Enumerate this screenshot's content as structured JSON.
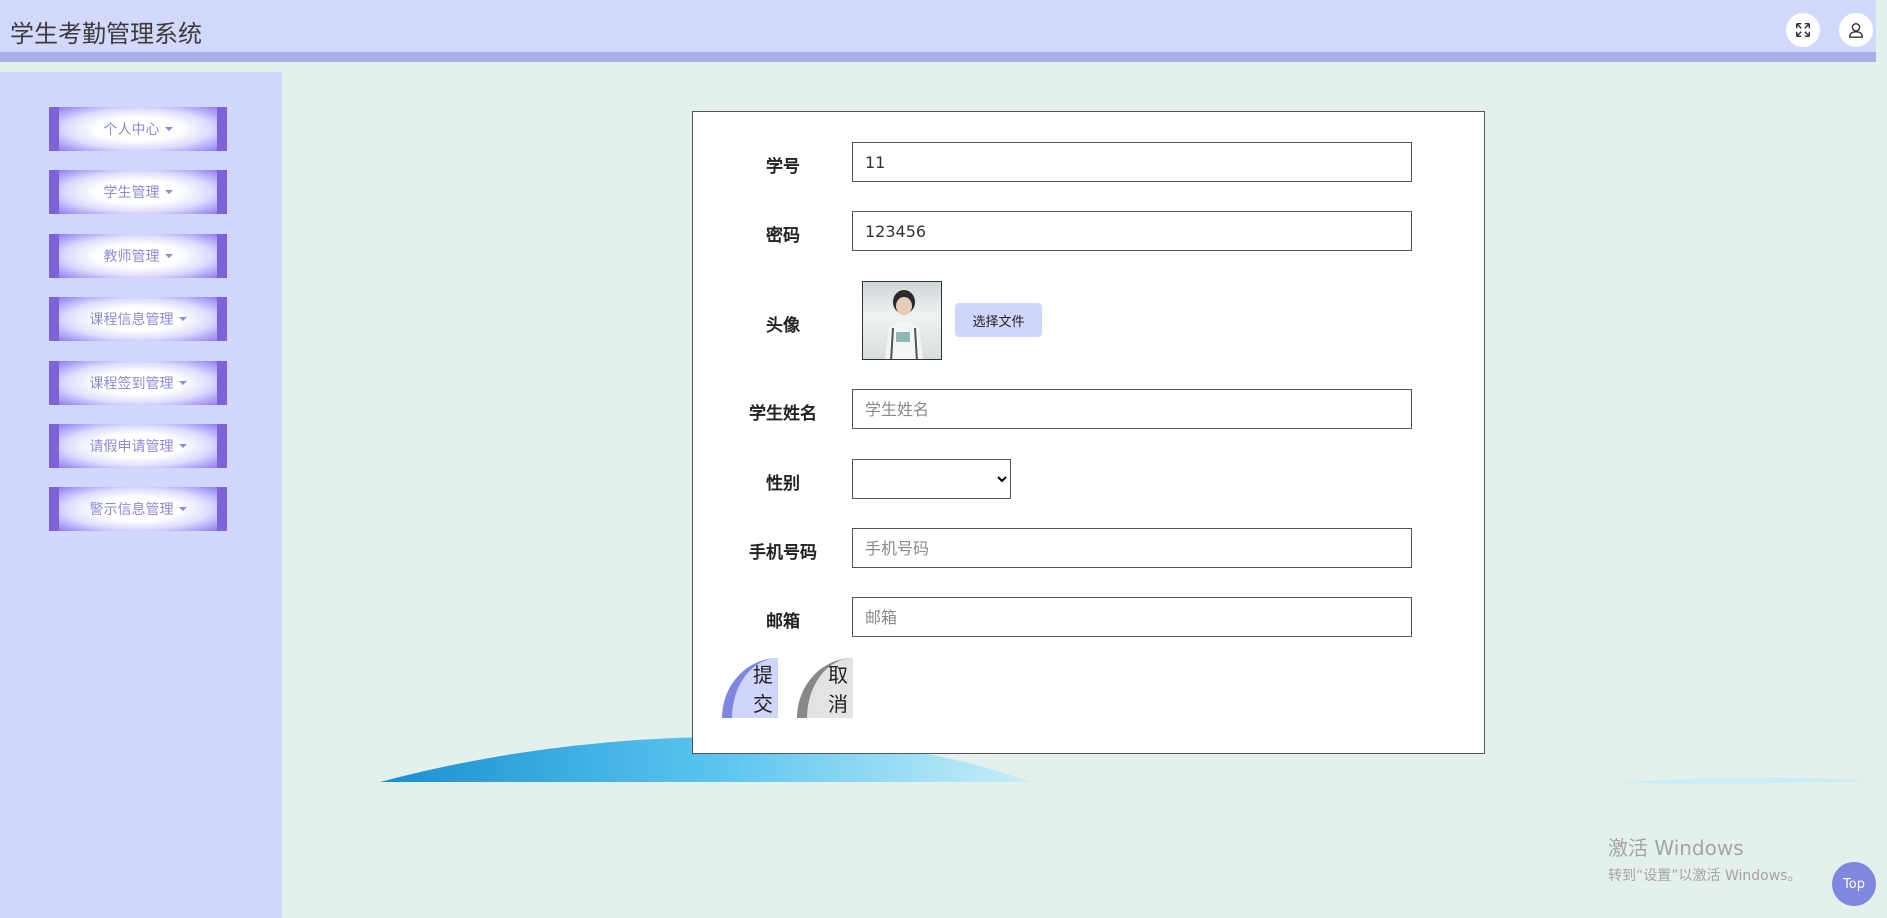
{
  "header": {
    "title": "学生考勤管理系统",
    "fullscreen_icon": "fullscreen-icon",
    "user_icon": "user-icon"
  },
  "sidebar": {
    "items": [
      {
        "label": "个人中心"
      },
      {
        "label": "学生管理"
      },
      {
        "label": "教师管理"
      },
      {
        "label": "课程信息管理"
      },
      {
        "label": "课程签到管理"
      },
      {
        "label": "请假申请管理"
      },
      {
        "label": "警示信息管理"
      }
    ]
  },
  "form": {
    "student_id": {
      "label": "学号",
      "value": "11"
    },
    "password": {
      "label": "密码",
      "value": "123456"
    },
    "avatar": {
      "label": "头像",
      "button": "选择文件"
    },
    "name": {
      "label": "学生姓名",
      "placeholder": "学生姓名"
    },
    "gender": {
      "label": "性别",
      "value": ""
    },
    "phone": {
      "label": "手机号码",
      "placeholder": "手机号码"
    },
    "email": {
      "label": "邮箱",
      "placeholder": "邮箱"
    },
    "submit_label": "提交",
    "cancel_label": "取消"
  },
  "watermark": {
    "title": "激活 Windows",
    "subtitle": "转到“设置”以激活 Windows。"
  },
  "top_button": "Top",
  "colors": {
    "header_bg": "#d3d8fd",
    "sidebar_bg": "#d2d7fe",
    "page_bg": "#e4f0eb",
    "accent": "#7d62d8"
  }
}
